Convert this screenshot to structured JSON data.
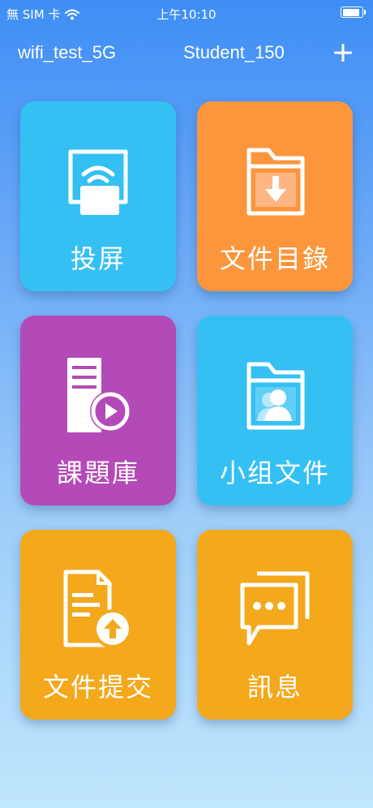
{
  "status_bar": {
    "carrier": "無 SIM 卡",
    "time": "上午10:10",
    "icons": [
      "wifi-icon",
      "battery-icon"
    ]
  },
  "header": {
    "wifi_name": "wifi_test_5G",
    "user_name": "Student_150",
    "add_icon": "plus-icon"
  },
  "colors": {
    "background_top": "#3f8ef5",
    "background_bottom": "#bfe6fc",
    "tile_cyan": "#35c0f4",
    "tile_orange": "#fc963c",
    "tile_purple": "#b44ab8",
    "tile_amber": "#f4a81c"
  },
  "tiles": [
    {
      "label": "投屏",
      "icon": "screen-cast-icon",
      "color": "#35c0f4"
    },
    {
      "label": "文件目錄",
      "icon": "folder-download-icon",
      "color": "#fc963c"
    },
    {
      "label": "課題庫",
      "icon": "question-bank-play-icon",
      "color": "#b44ab8"
    },
    {
      "label": "小组文件",
      "icon": "group-folder-icon",
      "color": "#35c0f4"
    },
    {
      "label": "文件提交",
      "icon": "file-upload-icon",
      "color": "#f4a81c"
    },
    {
      "label": "訊息",
      "icon": "chat-message-icon",
      "color": "#f4a81c"
    }
  ]
}
